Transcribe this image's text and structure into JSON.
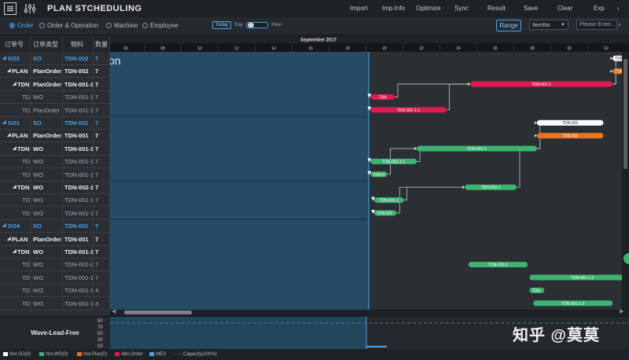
{
  "app": {
    "title": "PLAN  STCHEDULING",
    "menu": [
      "Import",
      "Imp.Info",
      "Optimize",
      "Sync",
      "Result",
      "Save",
      "Clear",
      "Exp"
    ]
  },
  "subbar": {
    "views": [
      {
        "label": "Order",
        "active": true
      },
      {
        "label": "Order & Operation",
        "active": false
      },
      {
        "label": "Machine",
        "active": false
      },
      {
        "label": "Employee",
        "active": false
      }
    ],
    "zoom": {
      "today": "Today",
      "day": "Day",
      "hour": "Hour"
    },
    "range_label": "Range",
    "select_value": "ItemNo",
    "search_placeholder": "Please Enter..."
  },
  "grid": {
    "headers": [
      "订单号",
      "订单类型",
      "物料",
      "数量"
    ],
    "rows": [
      {
        "kind": "so",
        "id": "SO2",
        "type": "SO",
        "item": "TDN-002",
        "qty": "7"
      },
      {
        "kind": "plan",
        "id": "PLAN",
        "type": "PlanOrder",
        "item": "TDN-002",
        "qty": "7"
      },
      {
        "kind": "plan",
        "id": "TDN",
        "type": "PlanOrder",
        "item": "TDN-001-1",
        "qty": "7"
      },
      {
        "kind": "td",
        "id": "TD",
        "type": "WO",
        "item": "TDN-001-1",
        "qty": "7"
      },
      {
        "kind": "td",
        "id": "TD",
        "type": "PlanOrder",
        "item": "TDN-001-1",
        "qty": "7"
      },
      {
        "kind": "so",
        "id": "SO1",
        "type": "SO",
        "item": "TDN-001",
        "qty": "7"
      },
      {
        "kind": "plan",
        "id": "PLAN",
        "type": "PlanOrder",
        "item": "TDN-001",
        "qty": "7"
      },
      {
        "kind": "plan",
        "id": "TDN",
        "type": "WO",
        "item": "TDN-001-1",
        "qty": "7"
      },
      {
        "kind": "td",
        "id": "TD",
        "type": "WO",
        "item": "TDN-001-1",
        "qty": "7"
      },
      {
        "kind": "td",
        "id": "TD",
        "type": "WO",
        "item": "TDN-001-1",
        "qty": "7"
      },
      {
        "kind": "plan",
        "id": "TDN",
        "type": "WO",
        "item": "TDN-002-1",
        "qty": "7"
      },
      {
        "kind": "td",
        "id": "TD",
        "type": "WO",
        "item": "TDN-001-1",
        "qty": "7"
      },
      {
        "kind": "td",
        "id": "TD",
        "type": "WO",
        "item": "TDN-001-1",
        "qty": "7"
      },
      {
        "kind": "so",
        "id": "SO4",
        "type": "SO",
        "item": "TDN-001",
        "qty": "7"
      },
      {
        "kind": "plan",
        "id": "PLAN",
        "type": "PlanOrder",
        "item": "TDN-001",
        "qty": "7"
      },
      {
        "kind": "plan",
        "id": "TDN",
        "type": "WO",
        "item": "TDN-001-1",
        "qty": "7"
      },
      {
        "kind": "td",
        "id": "TD",
        "type": "WO",
        "item": "TDN-002-2",
        "qty": "7"
      },
      {
        "kind": "td",
        "id": "TD",
        "type": "WO",
        "item": "TDN-001-1",
        "qty": "7"
      },
      {
        "kind": "td",
        "id": "TD",
        "type": "WO",
        "item": "TDN-001-1",
        "qty": "4"
      },
      {
        "kind": "td",
        "id": "TD",
        "type": "WO",
        "item": "TDN-001-1",
        "qty": "3"
      }
    ]
  },
  "timeline": {
    "month": "September 2017",
    "days": [
      "06",
      "08",
      "10",
      "12",
      "14",
      "16",
      "18",
      "20",
      "22",
      "24",
      "26",
      "28",
      "30",
      "02"
    ],
    "past_day_index": 7,
    "shaded_row_text": "on"
  },
  "bars": [
    {
      "label": "TDN-002",
      "color": "#ffffff",
      "row": 0,
      "start": 13.6,
      "end": 14.1,
      "arrow": false
    },
    {
      "label": "TDN-002",
      "color": "#e8731e",
      "row": 1,
      "start": 13.6,
      "end": 14.1,
      "arrow": false
    },
    {
      "label": "TDN-001-1",
      "color": "#e01a4f",
      "row": 2,
      "start": 9.75,
      "end": 13.6,
      "arrow": false
    },
    {
      "label": "TDN",
      "color": "#e01a4f",
      "row": 3,
      "start": 7.05,
      "end": 7.7,
      "arrow": true
    },
    {
      "label": "TDN-001-1-1",
      "color": "#e01a4f",
      "row": 4,
      "start": 7.05,
      "end": 9.1,
      "arrow": true
    },
    {
      "label": "TDN-001",
      "color": "#ffffff",
      "row": 5,
      "start": 11.55,
      "end": 13.35,
      "arrow": false
    },
    {
      "label": "TDN-001",
      "color": "#e8731e",
      "row": 6,
      "start": 11.55,
      "end": 13.35,
      "arrow": false
    },
    {
      "label": "TDN-001-1",
      "color": "#3cb371",
      "row": 7,
      "start": 8.3,
      "end": 11.55,
      "arrow": false
    },
    {
      "label": "TDN-001-1-1",
      "color": "#3cb371",
      "row": 8,
      "start": 7.05,
      "end": 8.3,
      "arrow": true
    },
    {
      "label": "TDN-0",
      "color": "#3cb371",
      "row": 9,
      "start": 7.05,
      "end": 7.5,
      "arrow": true
    },
    {
      "label": "TDN-002-1",
      "color": "#3cb371",
      "row": 10,
      "start": 9.6,
      "end": 11.0,
      "arrow": false
    },
    {
      "label": "TDN-001-1",
      "color": "#3cb371",
      "row": 11,
      "start": 7.15,
      "end": 7.95,
      "arrow": true
    },
    {
      "label": "TDN-001",
      "color": "#3cb371",
      "row": 12,
      "start": 7.15,
      "end": 7.75,
      "arrow": true
    },
    {
      "label": "TDN-002-2",
      "color": "#3cb371",
      "row": 16,
      "start": 9.7,
      "end": 11.3,
      "arrow": false
    },
    {
      "label": "TDN-001-1-2",
      "color": "#3cb371",
      "row": 17,
      "start": 11.35,
      "end": 14.2,
      "arrow": false
    },
    {
      "label": "TDN",
      "color": "#3cb371",
      "row": 18,
      "start": 11.35,
      "end": 11.75,
      "arrow": false
    },
    {
      "label": "TDN-001-1-2",
      "color": "#3cb371",
      "row": 19,
      "start": 11.45,
      "end": 13.6,
      "arrow": false
    }
  ],
  "links": [
    [
      4,
      2
    ],
    [
      3,
      2
    ],
    [
      2,
      0
    ],
    [
      2,
      1
    ],
    [
      8,
      7
    ],
    [
      9,
      7
    ],
    [
      7,
      5
    ],
    [
      7,
      6
    ],
    [
      11,
      10
    ],
    [
      12,
      10
    ],
    [
      10,
      7
    ],
    [
      16,
      17
    ]
  ],
  "load": {
    "label": "Wave-Lead-Free",
    "axis": [
      "50",
      "70",
      "50",
      "30",
      "10"
    ]
  },
  "legend": [
    {
      "label": "Nor.SO(0)",
      "color": "#ffffff"
    },
    {
      "label": "Nor.WO(0)",
      "color": "#3cb371"
    },
    {
      "label": "Nor.Plan(0)",
      "color": "#e8731e"
    },
    {
      "label": "Abn.Order",
      "color": "#e01a4f"
    },
    {
      "label": "MES",
      "color": "#4aa3e8"
    },
    {
      "label": "Capacity(100%)",
      "color": "#3cb371"
    }
  ],
  "watermark": "知乎 @莫莫"
}
